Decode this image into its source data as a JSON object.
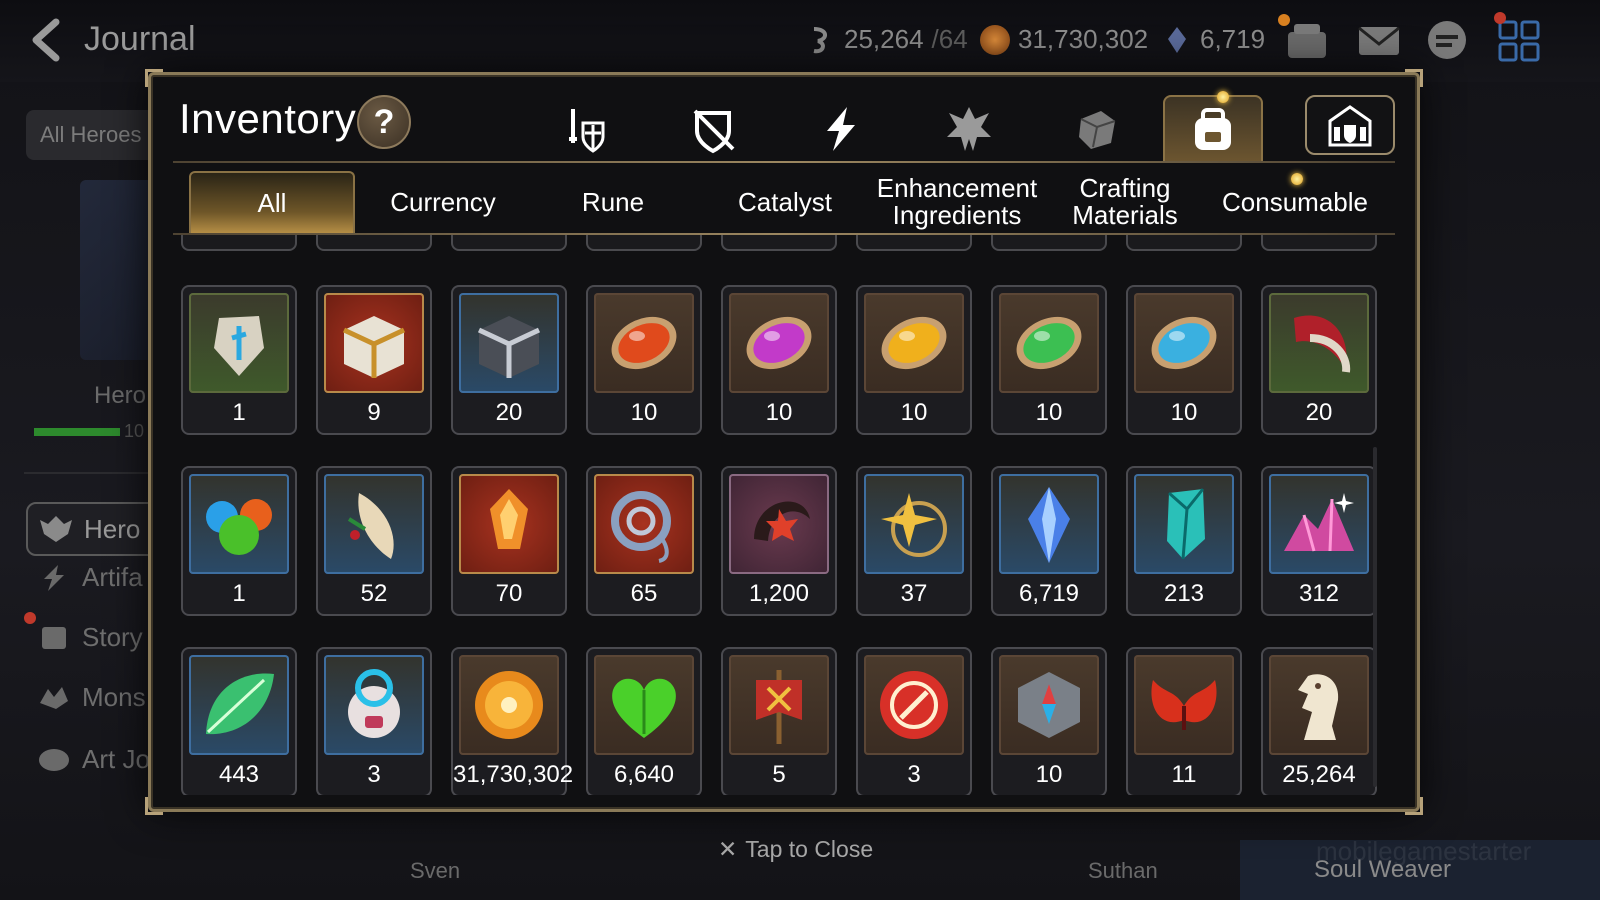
{
  "header": {
    "title": "Journal",
    "resources": [
      {
        "icon": "stamina-icon",
        "value": "25,264",
        "max": "/64"
      },
      {
        "icon": "gold-icon",
        "value": "31,730,302"
      },
      {
        "icon": "crystal-icon",
        "value": "6,719"
      }
    ]
  },
  "sidebar": {
    "filter_label": "All Heroes",
    "hero_label": "Hero",
    "hero_bar_value": "10",
    "items": [
      {
        "label": "Hero J",
        "icon": "hero-icon"
      },
      {
        "label": "Artifa",
        "icon": "artifact-icon"
      },
      {
        "label": "Story",
        "icon": "story-icon"
      },
      {
        "label": "Mons",
        "icon": "monster-icon"
      },
      {
        "label": "Art Jo",
        "icon": "art-icon"
      }
    ]
  },
  "background_names": {
    "left": "Sven",
    "right": "Suthan",
    "soul": "Soul Weaver",
    "watermark": "mobilegamestarter"
  },
  "modal": {
    "title": "Inventory",
    "help_label": "?",
    "categories": [
      {
        "name": "equipment-icon",
        "active": false
      },
      {
        "name": "no-gear-icon",
        "active": false
      },
      {
        "name": "artifact-bolt-icon",
        "active": false
      },
      {
        "name": "hero-material-icon",
        "active": false
      },
      {
        "name": "material-cube-icon",
        "active": false
      },
      {
        "name": "bag-icon",
        "active": true
      },
      {
        "name": "storage-icon",
        "active": false
      }
    ],
    "subtabs": [
      {
        "label": "All",
        "active": true
      },
      {
        "label": "Currency",
        "active": false
      },
      {
        "label": "Rune",
        "active": false
      },
      {
        "label": "Catalyst",
        "active": false
      },
      {
        "label": "Enhancement Ingredients",
        "active": false
      },
      {
        "label": "Crafting Materials",
        "active": false
      },
      {
        "label": "Consumable",
        "active": false
      }
    ],
    "close_label": "Tap to Close"
  },
  "items": [
    [
      {
        "name": "rune-stone-icon",
        "bg": "green",
        "qty": "1"
      },
      {
        "name": "gold-chest-icon",
        "bg": "red",
        "qty": "9"
      },
      {
        "name": "silver-chest-icon",
        "bg": "blue",
        "qty": "20"
      },
      {
        "name": "red-gem-icon",
        "bg": "brown",
        "qty": "10",
        "color": "#e04a1c"
      },
      {
        "name": "purple-gem-icon",
        "bg": "brown",
        "qty": "10",
        "color": "#c23ac9"
      },
      {
        "name": "yellow-gem-icon",
        "bg": "brown",
        "qty": "10",
        "color": "#f0b01c"
      },
      {
        "name": "green-gem-icon",
        "bg": "brown",
        "qty": "10",
        "color": "#3cbf52"
      },
      {
        "name": "blue-gem-icon",
        "bg": "brown",
        "qty": "10",
        "color": "#3ab0e0"
      },
      {
        "name": "claw-icon",
        "bg": "green",
        "qty": "20"
      }
    ],
    [
      {
        "name": "slime-orbs-icon",
        "bg": "blue",
        "qty": "1"
      },
      {
        "name": "feather-icon",
        "bg": "blue",
        "qty": "52"
      },
      {
        "name": "flame-crystal-icon",
        "bg": "red",
        "qty": "70"
      },
      {
        "name": "ring-coil-icon",
        "bg": "red",
        "qty": "65"
      },
      {
        "name": "crescent-flower-icon",
        "bg": "purple",
        "qty": "1,200"
      },
      {
        "name": "star-amulet-icon",
        "bg": "blue",
        "qty": "37"
      },
      {
        "name": "blue-crystal-icon",
        "bg": "blue",
        "qty": "6,719"
      },
      {
        "name": "teal-crystal-icon",
        "bg": "blue",
        "qty": "213"
      },
      {
        "name": "pink-crystal-pile-icon",
        "bg": "blue",
        "qty": "312"
      }
    ],
    [
      {
        "name": "leaf-icon",
        "bg": "blue",
        "qty": "443"
      },
      {
        "name": "robot-pet-icon",
        "bg": "blue",
        "qty": "3"
      },
      {
        "name": "gold-coin-icon",
        "bg": "brown",
        "qty": "31,730,302"
      },
      {
        "name": "green-heart-icon",
        "bg": "brown",
        "qty": "6,640"
      },
      {
        "name": "banner-icon",
        "bg": "brown",
        "qty": "5"
      },
      {
        "name": "red-seal-icon",
        "bg": "brown",
        "qty": "3"
      },
      {
        "name": "compass-cube-icon",
        "bg": "brown",
        "qty": "10"
      },
      {
        "name": "red-wings-icon",
        "bg": "brown",
        "qty": "11"
      },
      {
        "name": "horse-chess-icon",
        "bg": "brown",
        "qty": "25,264"
      }
    ]
  ]
}
